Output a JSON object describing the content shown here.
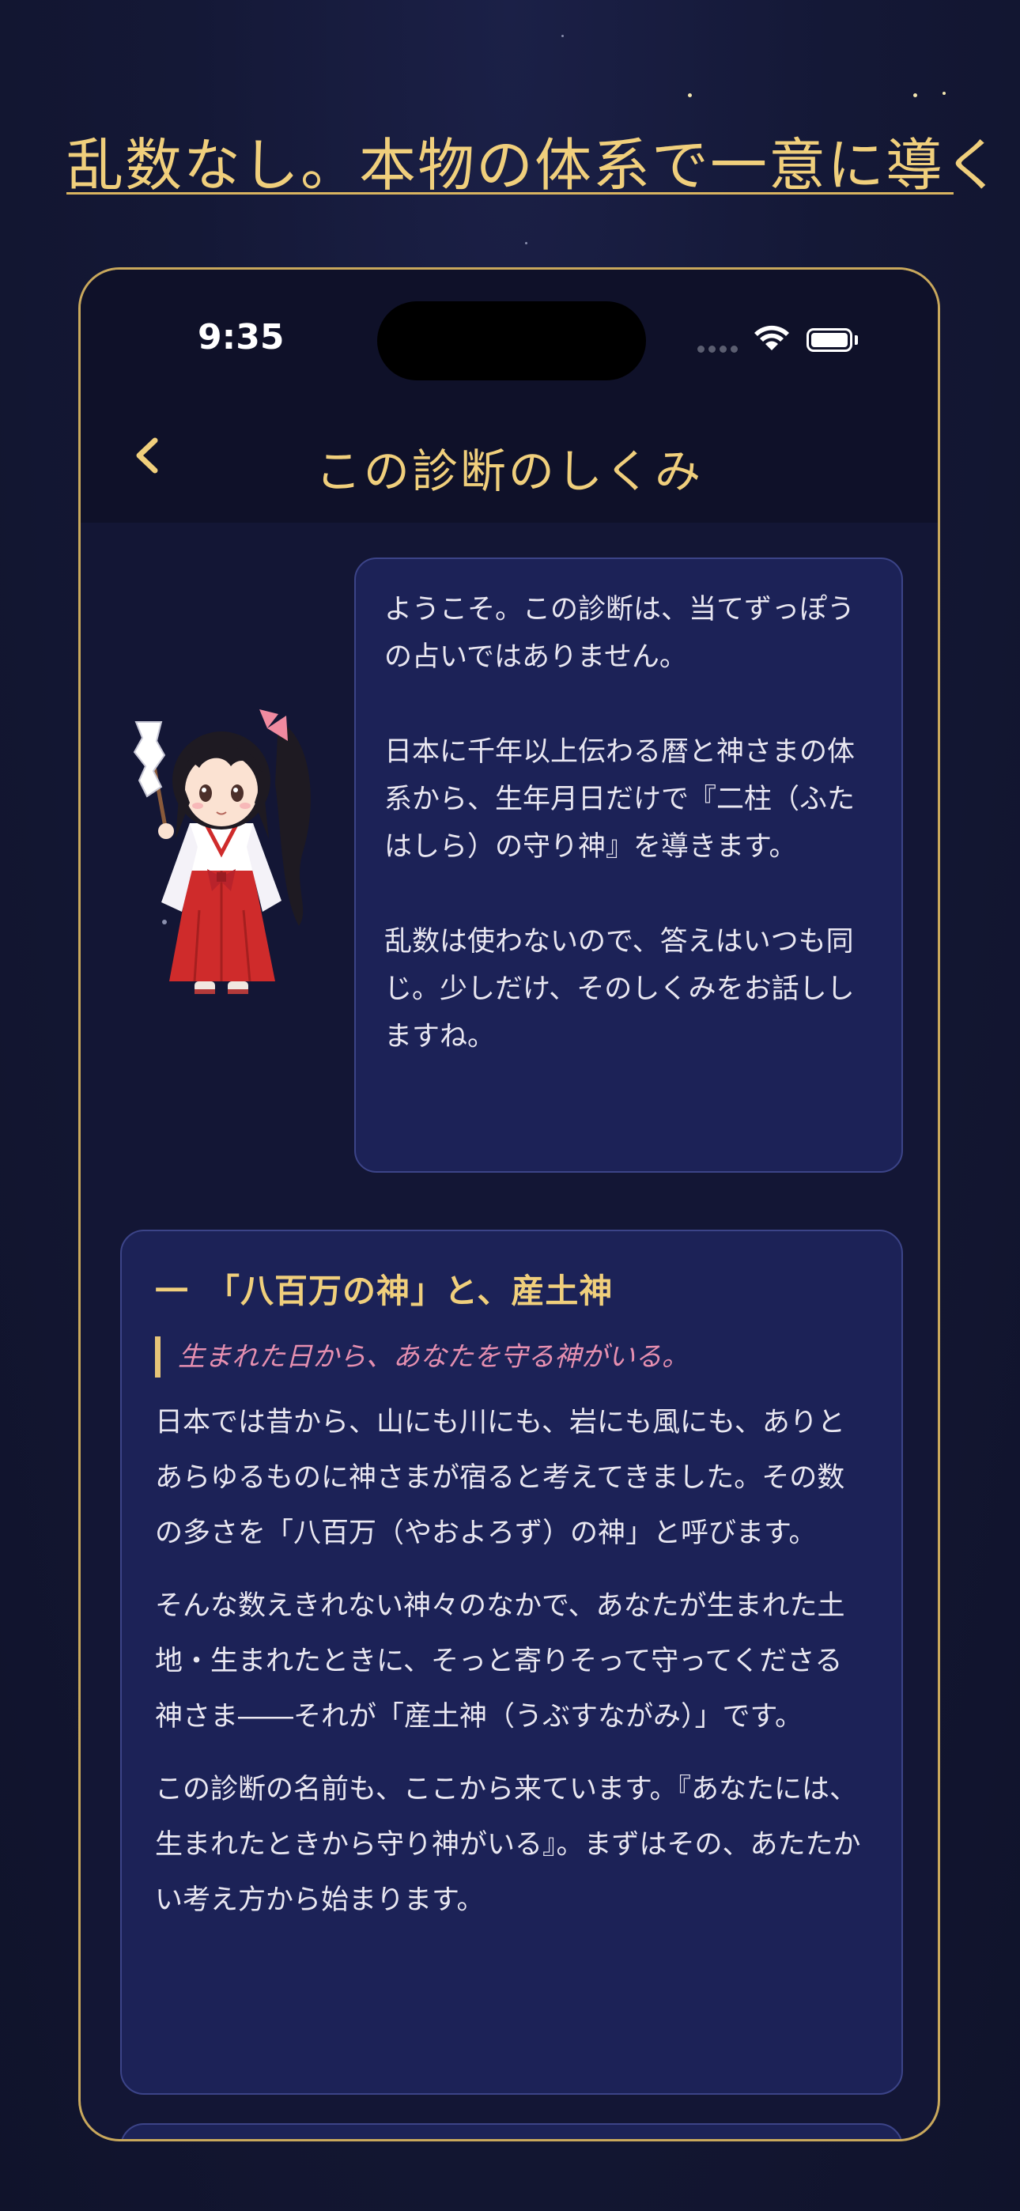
{
  "headline": "乱数なし。本物の体系で一意に導く",
  "status_bar": {
    "time": "9:35"
  },
  "nav": {
    "title": "この診断のしくみ"
  },
  "intro_bubble": {
    "paragraphs": [
      "ようこそ。この診断は、当てずっぽうの占いではありません。",
      "日本に千年以上伝わる暦と神さまの体系から、生年月日だけで『二柱（ふたはしら）の守り神』を導きます。",
      "乱数は使わないので、答えはいつも同じ。少しだけ、そのしくみをお話ししますね。"
    ]
  },
  "section1": {
    "title": "一　「八百万の神」と、産土神",
    "quote": "生まれた日から、あなたを守る神がいる。",
    "paragraphs": [
      "日本では昔から、山にも川にも、岩にも風にも、ありとあらゆるものに神さまが宿ると考えてきました。その数の多さを「八百万（やおよろず）の神」と呼びます。",
      "そんな数えきれない神々のなかで、あなたが生まれた土地・生まれたときに、そっと寄りそって守ってくださる神さま――それが「産土神（うぶすながみ）」です。",
      "この診断の名前も、ここから来ています。『あなたには、生まれたときから守り神がいる』。まずはその、あたたかい考え方から始まります。"
    ]
  },
  "colors": {
    "accent_gold": "#f0cf7c",
    "border_gold": "#c9a85c",
    "card_bg": "#1c2257",
    "quote_pink": "#e58fb0"
  }
}
